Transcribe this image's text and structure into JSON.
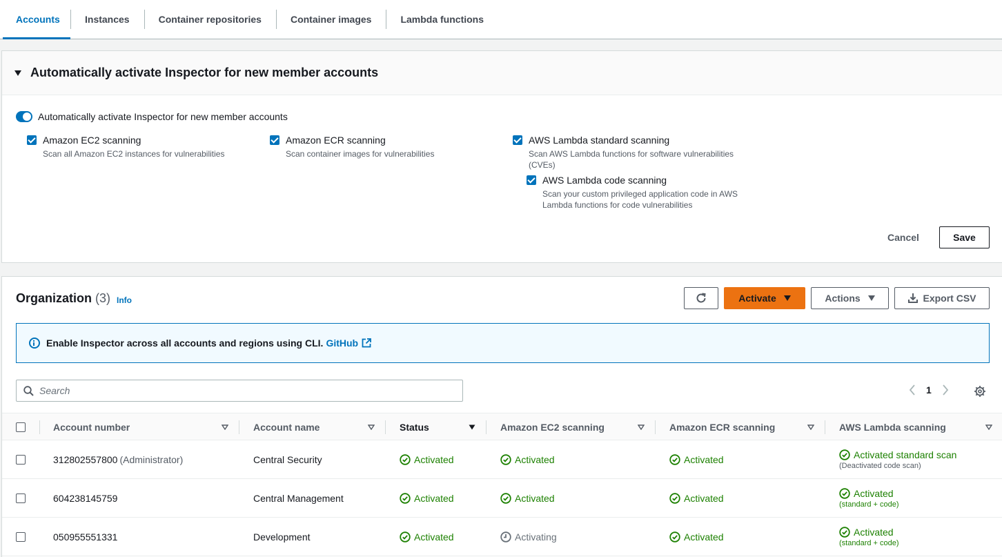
{
  "tabs": [
    {
      "label": "Accounts",
      "active": true
    },
    {
      "label": "Instances",
      "active": false
    },
    {
      "label": "Container repositories",
      "active": false
    },
    {
      "label": "Container images",
      "active": false
    },
    {
      "label": "Lambda functions",
      "active": false
    }
  ],
  "auto_activate": {
    "title": "Automatically activate Inspector for new member accounts",
    "toggle_label": "Automatically activate Inspector for new member accounts",
    "ec2": {
      "label": "Amazon EC2 scanning",
      "desc": "Scan all Amazon EC2 instances for vulnerabilities"
    },
    "ecr": {
      "label": "Amazon ECR scanning",
      "desc": "Scan container images for vulnerabilities"
    },
    "lambda_std": {
      "label": "AWS Lambda standard scanning",
      "desc": "Scan AWS Lambda functions for software vulnerabilities (CVEs)"
    },
    "lambda_code": {
      "label": "AWS Lambda code scanning",
      "desc": "Scan your custom privileged application code in AWS Lambda functions for code vulnerabilities"
    },
    "cancel_label": "Cancel",
    "save_label": "Save"
  },
  "organization": {
    "title": "Organization",
    "count": "(3)",
    "info": "Info",
    "activate_label": "Activate",
    "actions_label": "Actions",
    "export_label": "Export CSV",
    "alert_text": "Enable Inspector across all accounts and regions using CLI.",
    "alert_link": "GitHub",
    "search_placeholder": "Search",
    "page": "1"
  },
  "table": {
    "columns": [
      "Account number",
      "Account name",
      "Status",
      "Amazon EC2 scanning",
      "Amazon ECR scanning",
      "AWS Lambda scanning"
    ],
    "rows": [
      {
        "account_number": "312802557800",
        "admin": "(Administrator)",
        "account_name": "Central Security",
        "status": "Activated",
        "ec2": "Activated",
        "ecr": "Activated",
        "lambda": "Activated standard scan",
        "lambda_sub": "(Deactivated code scan)"
      },
      {
        "account_number": "604238145759",
        "admin": "",
        "account_name": "Central Management",
        "status": "Activated",
        "ec2": "Activated",
        "ecr": "Activated",
        "lambda": "Activated",
        "lambda_sub": "(standard + code)"
      },
      {
        "account_number": "050955551331",
        "admin": "",
        "account_name": "Development",
        "status": "Activated",
        "ec2": "Activating",
        "ecr": "Activated",
        "lambda": "Activated",
        "lambda_sub": "(standard + code)"
      }
    ]
  },
  "colors": {
    "accent": "#0073bb",
    "primary_button": "#ec7211",
    "success": "#1d8102",
    "pending": "#687078"
  },
  "icons": [
    "caret-down-icon",
    "refresh-icon",
    "download-icon",
    "info-icon",
    "external-link-icon",
    "search-icon",
    "chevron-left-icon",
    "chevron-right-icon",
    "gear-icon",
    "check-circle-icon",
    "clock-icon",
    "sort-icon"
  ]
}
